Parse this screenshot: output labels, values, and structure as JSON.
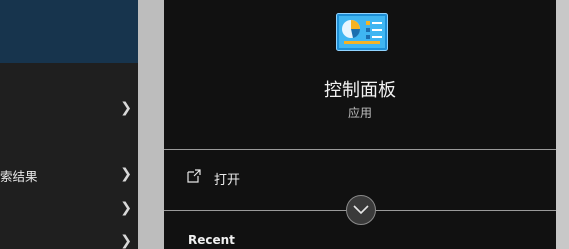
{
  "left_list": {
    "items": [
      {
        "label": ""
      },
      {
        "label": ""
      },
      {
        "label": "索结果"
      },
      {
        "label": ""
      },
      {
        "label": ""
      }
    ]
  },
  "app": {
    "name": "控制面板",
    "type": "应用",
    "icon": "control-panel-icon"
  },
  "actions": {
    "open_label": "打开",
    "open_icon": "open-external-icon"
  },
  "expand": {
    "icon": "chevron-down-icon"
  },
  "recent": {
    "heading": "Recent"
  },
  "colors": {
    "selected_bg": "#17344d",
    "panel_bg": "#111111",
    "sidebar_bg": "#1f1f1f"
  }
}
